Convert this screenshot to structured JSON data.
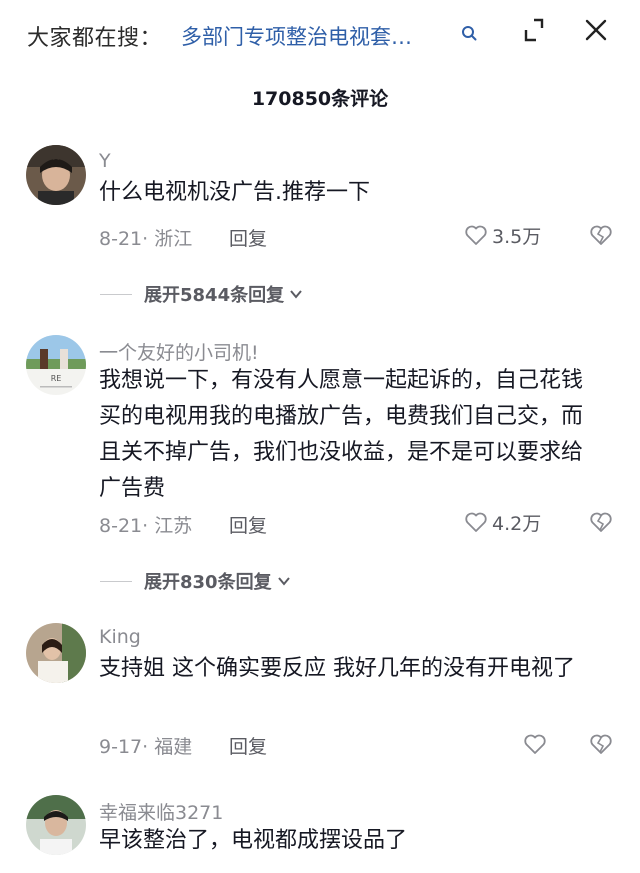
{
  "header": {
    "search_prefix": "大家都在搜：",
    "search_query": "多部门专项整治电视套…",
    "icons": {
      "search": "search-icon",
      "minimize": "minimize-icon",
      "close": "close-icon"
    }
  },
  "comment_count": "170850条评论",
  "comments": [
    {
      "username": "Y",
      "text": "什么电视机没广告.推荐一下",
      "date_location": "8-21· 浙江",
      "reply_label": "回复",
      "likes": "3.5万",
      "expand_label": "展开5844条回复"
    },
    {
      "username": "一个友好的小司机!",
      "text": "我想说一下，有没有人愿意一起起诉的，自己花钱买的电视用我的电播放广告，电费我们自己交，而且关不掉广告，我们也没收益，是不是可以要求给广告费",
      "date_location": "8-21· 江苏",
      "reply_label": "回复",
      "likes": "4.2万",
      "expand_label": "展开830条回复"
    },
    {
      "username": "King",
      "text": "支持姐  这个确实要反应  我好几年的没有开电视了",
      "date_location": "9-17· 福建",
      "reply_label": "回复",
      "likes": ""
    },
    {
      "username": "幸福来临3271",
      "text": "早该整治了，电视都成摆设品了"
    }
  ],
  "colors": {
    "link": "#2f5fa8",
    "muted": "#8a8b91",
    "text": "#161823"
  }
}
